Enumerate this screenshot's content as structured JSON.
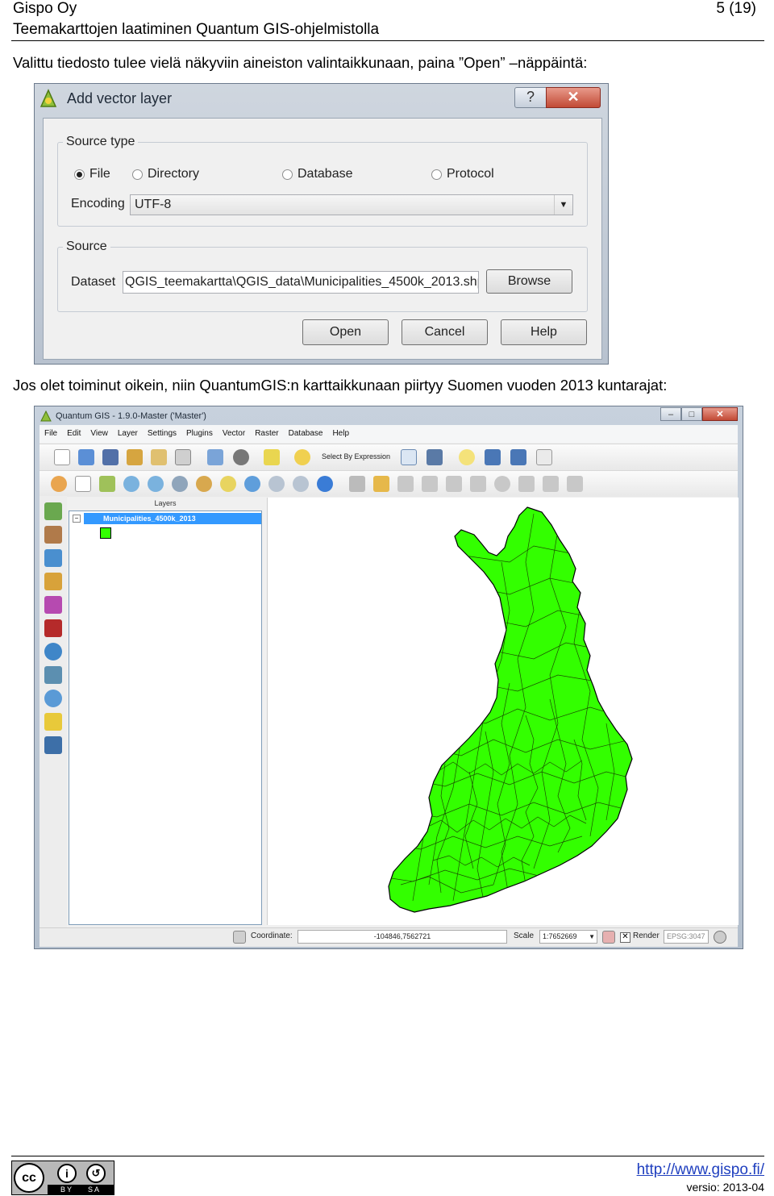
{
  "header": {
    "company": "Gispo Oy",
    "page": "5 (19)",
    "doc_title": "Teemakarttojen laatiminen Quantum GIS-ohjelmistolla"
  },
  "intro_text": "Valittu tiedosto tulee vielä näkyviin aineiston valintaikkunaan, paina ”Open” –näppäintä:",
  "dialog": {
    "title": "Add vector layer",
    "help_symbol": "?",
    "close_symbol": "✕",
    "source_type_legend": "Source type",
    "radios": [
      "File",
      "Directory",
      "Database",
      "Protocol"
    ],
    "selected_radio": "File",
    "encoding_label": "Encoding",
    "encoding_value": "UTF-8",
    "source_legend": "Source",
    "dataset_label": "Dataset",
    "dataset_value": "QGIS_teemakartta\\QGIS_data\\Municipalities_4500k_2013.shp",
    "browse_label": "Browse",
    "open_label": "Open",
    "cancel_label": "Cancel",
    "help_label": "Help"
  },
  "second_text": "Jos olet toiminut oikein, niin QuantumGIS:n karttaikkunaan piirtyy Suomen vuoden 2013 kuntarajat:",
  "qgis": {
    "title": "Quantum GIS - 1.9.0-Master ('Master')",
    "menus": [
      "File",
      "Edit",
      "View",
      "Layer",
      "Settings",
      "Plugins",
      "Vector",
      "Raster",
      "Database",
      "Help"
    ],
    "select_by_expression": "Select By Expression",
    "layers_panel_title": "Layers",
    "layer_name": "Municipalities_4500k_2013",
    "layer_color": "#33ff00",
    "status": {
      "coordinate_label": "Coordinate:",
      "coordinate_value": "-104846,7562721",
      "scale_label": "Scale",
      "scale_value": "1:7652669",
      "render_label": "Render",
      "epsg": "EPSG:3047"
    }
  },
  "footer": {
    "license_badge": "cc BY SA",
    "url": "http://www.gispo.fi/",
    "version": "versio: 2013-04"
  }
}
